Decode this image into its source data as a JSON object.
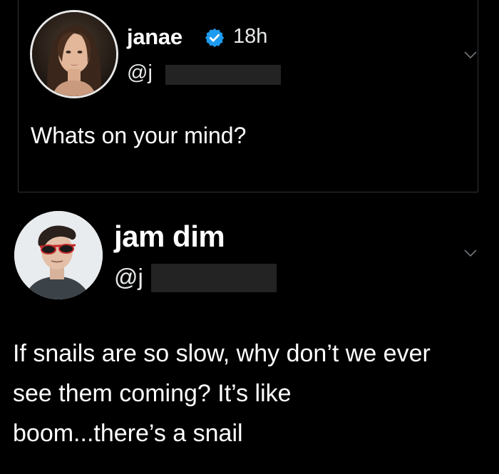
{
  "tweets": [
    {
      "display_name": "janae",
      "verified": true,
      "timestamp": "18h",
      "handle_visible": "@j",
      "text": "Whats on your mind?",
      "avatar_icon": "woman-portrait-avatar",
      "menu_icon": "chevron-down-icon"
    },
    {
      "display_name": "jam dim",
      "verified": false,
      "handle_visible": "@j",
      "text": "If snails are so slow, why don’t we ever\nsee them coming? It’s like\nboom...there’s a snail",
      "avatar_icon": "man-with-sunglasses-avatar",
      "menu_icon": "chevron-down-icon"
    }
  ],
  "colors": {
    "background": "#000000",
    "text": "#ffffff",
    "verified_badge": "#1d9bf0",
    "redaction": "#232323",
    "border": "#2f3336"
  }
}
